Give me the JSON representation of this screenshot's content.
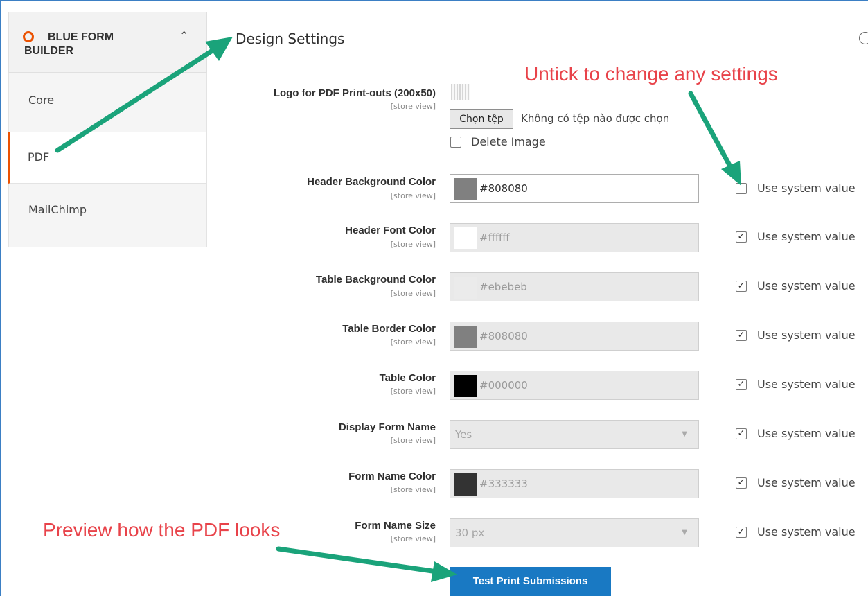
{
  "sidebar": {
    "title": "BLUE FORM BUILDER",
    "items": [
      {
        "label": "Core"
      },
      {
        "label": "PDF"
      },
      {
        "label": "MailChimp"
      }
    ]
  },
  "section_title": "Design Settings",
  "logo_row": {
    "label": "Logo for PDF Print-outs (200x50)",
    "scope": "[store view]",
    "file_button": "Chọn tệp",
    "file_status": "Không có tệp nào được chọn",
    "delete_label": "Delete Image"
  },
  "use_system_label": "Use system value",
  "rows": [
    {
      "label": "Header Background Color",
      "scope": "[store view]",
      "value": "#808080",
      "swatch": "#808080",
      "use_system": false
    },
    {
      "label": "Header Font Color",
      "scope": "[store view]",
      "value": "#ffffff",
      "swatch": "#ffffff",
      "use_system": true
    },
    {
      "label": "Table Background Color",
      "scope": "[store view]",
      "value": "#ebebeb",
      "swatch": "#ebebeb",
      "use_system": true
    },
    {
      "label": "Table Border Color",
      "scope": "[store view]",
      "value": "#808080",
      "swatch": "#808080",
      "use_system": true
    },
    {
      "label": "Table Color",
      "scope": "[store view]",
      "value": "#000000",
      "swatch": "#000000",
      "use_system": true
    },
    {
      "label": "Display Form Name",
      "scope": "[store view]",
      "value": "Yes",
      "use_system": true
    },
    {
      "label": "Form Name Color",
      "scope": "[store view]",
      "value": "#333333",
      "swatch": "#333333",
      "use_system": true
    },
    {
      "label": "Form Name Size",
      "scope": "[store view]",
      "value": "30 px",
      "use_system": true
    }
  ],
  "test_button": "Test Print Submissions",
  "annotations": {
    "untick": "Untick to change any settings",
    "preview": "Preview how the PDF looks"
  },
  "colors": {
    "accent": "#eb5202",
    "button": "#1979c3",
    "annotation": "#e8434a",
    "arrow": "#1aa37a"
  }
}
